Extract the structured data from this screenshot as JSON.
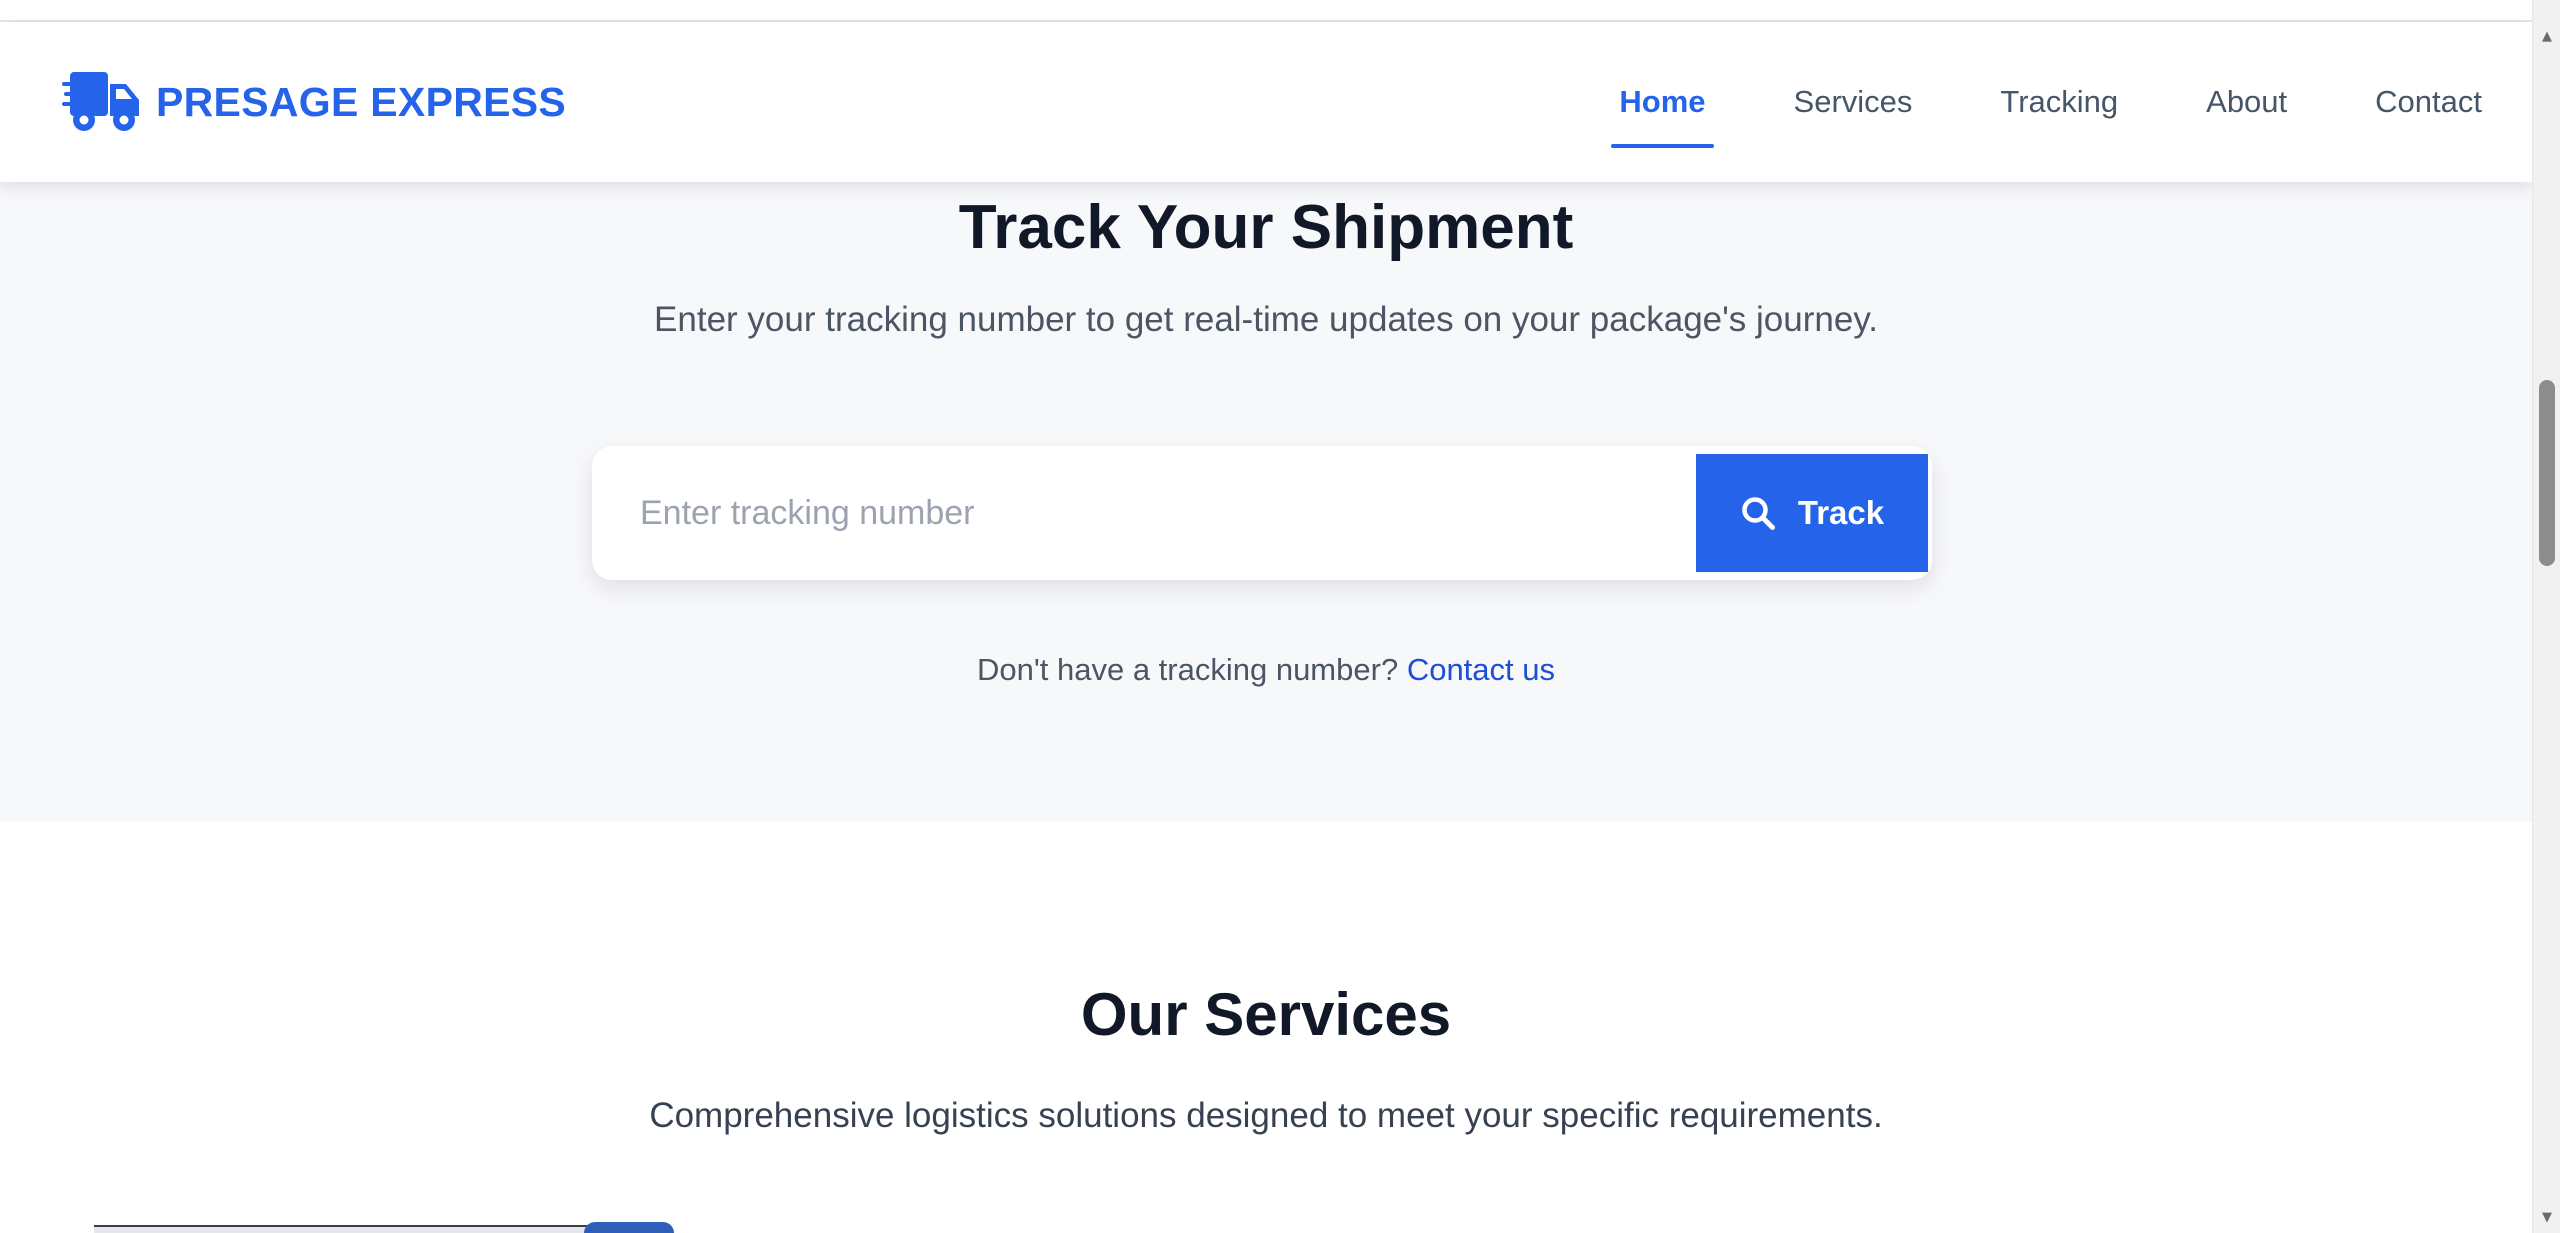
{
  "brand": {
    "name": "PRESAGE EXPRESS",
    "color": "#2563eb",
    "logo_icon": "truck-fast-icon"
  },
  "nav": {
    "items": [
      {
        "label": "Home",
        "active": true
      },
      {
        "label": "Services",
        "active": false
      },
      {
        "label": "Tracking",
        "active": false
      },
      {
        "label": "About",
        "active": false
      },
      {
        "label": "Contact",
        "active": false
      }
    ]
  },
  "tracking": {
    "title": "Track Your Shipment",
    "subtitle": "Enter your tracking number to get real-time updates on your package's journey.",
    "input_placeholder": "Enter tracking number",
    "input_value": "",
    "button_label": "Track",
    "button_icon": "search-icon",
    "help_text": "Don't have a tracking number?",
    "help_link": "Contact us"
  },
  "services": {
    "title": "Our Services",
    "subtitle": "Comprehensive logistics solutions designed to meet your specific requirements."
  },
  "colors": {
    "accent": "#2563eb",
    "heading": "#111827",
    "section_bg": "#f7f8fa"
  }
}
